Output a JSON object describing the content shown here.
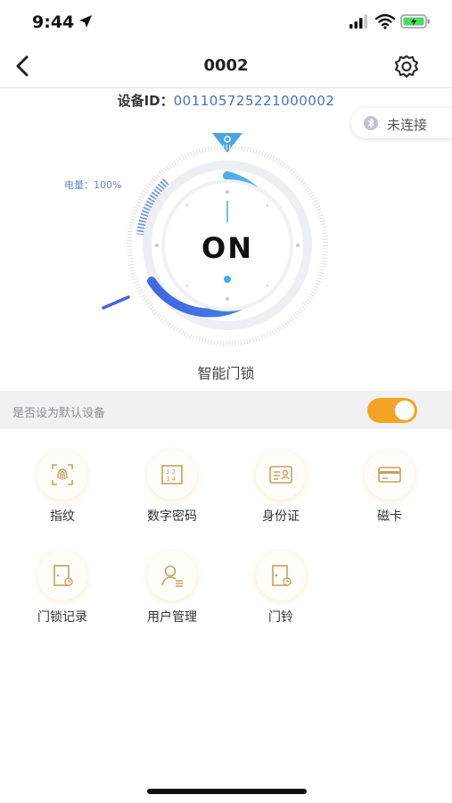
{
  "status": {
    "time": "9:44"
  },
  "nav": {
    "title": "0002"
  },
  "device": {
    "id_label": "设备ID：",
    "id_value": "001105725221000002"
  },
  "connection": {
    "label": "未连接"
  },
  "lock": {
    "battery": "电量：100%",
    "state": "ON",
    "name": "智能门锁"
  },
  "settings": {
    "default_label": "是否设为默认设备",
    "default_on": true
  },
  "menu": [
    {
      "label": "指纹",
      "icon": "fingerprint-icon"
    },
    {
      "label": "数字密码",
      "icon": "keypad-icon"
    },
    {
      "label": "身份证",
      "icon": "id-card-icon"
    },
    {
      "label": "磁卡",
      "icon": "card-icon"
    },
    {
      "label": "门锁记录",
      "icon": "door-record-icon"
    },
    {
      "label": "用户管理",
      "icon": "user-manage-icon"
    },
    {
      "label": "门铃",
      "icon": "doorbell-icon"
    }
  ],
  "colors": {
    "accent": "#f3a425",
    "blue": "#4b6fc6",
    "icon_gold": "#c9a062"
  }
}
